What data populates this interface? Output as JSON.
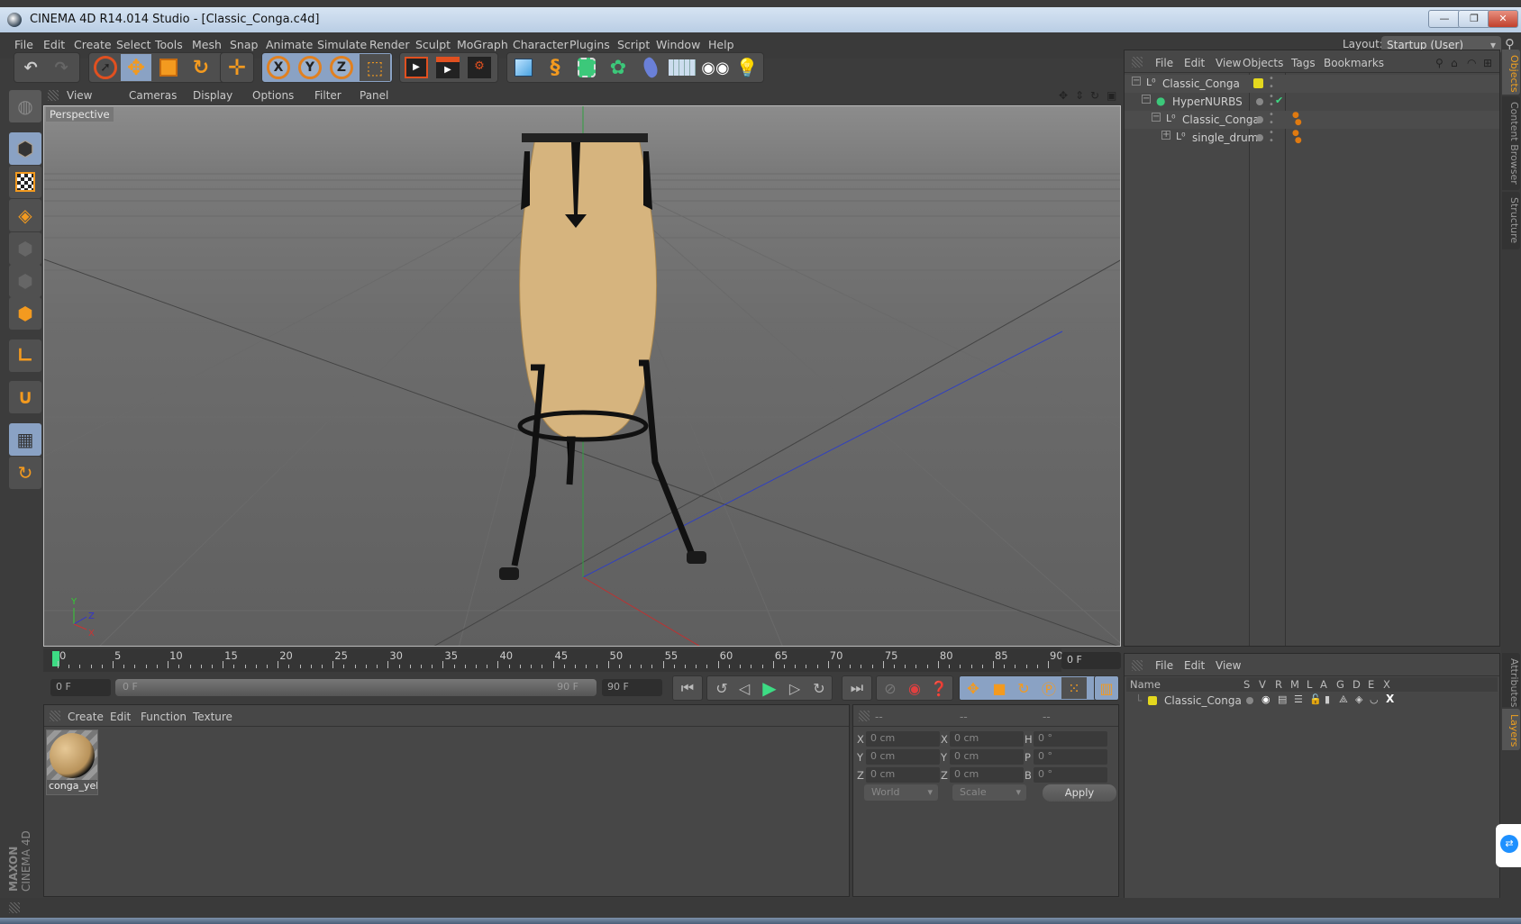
{
  "window": {
    "title": "CINEMA 4D R14.014 Studio - [Classic_Conga.c4d]",
    "controls": {
      "minimize": "—",
      "restore": "❐",
      "close": "✕"
    }
  },
  "menubar": {
    "items": [
      "File",
      "Edit",
      "Create",
      "Select",
      "Tools",
      "Mesh",
      "Snap",
      "Animate",
      "Simulate",
      "Render",
      "Sculpt",
      "MoGraph",
      "Character",
      "Plugins",
      "Script",
      "Window",
      "Help"
    ],
    "layout_label": "Layout:",
    "layout_value": "Startup (User)"
  },
  "toolbar": {
    "groups": [
      {
        "name": "history",
        "tools": [
          "undo-icon",
          "redo-icon"
        ]
      },
      {
        "name": "transform",
        "tools": [
          "live-selection-icon",
          "move-icon",
          "scale-icon",
          "rotate-icon"
        ]
      },
      {
        "name": "last-tool",
        "tools": [
          "create-tool-icon"
        ]
      },
      {
        "name": "axis-lock",
        "tools": [
          "x-axis-icon",
          "y-axis-icon",
          "z-axis-icon",
          "coordinate-system-icon"
        ]
      },
      {
        "name": "render",
        "tools": [
          "render-view-icon",
          "render-picture-viewer-icon",
          "render-settings-icon"
        ]
      },
      {
        "name": "create",
        "tools": [
          "cube-icon",
          "spline-icon",
          "nurbs-icon",
          "array-icon",
          "deformer-icon",
          "floor-icon",
          "camera-icon",
          "light-icon"
        ]
      }
    ],
    "axis_labels": [
      "X",
      "Y",
      "Z"
    ]
  },
  "left_tools": [
    "workplane-icon",
    "model-mode-icon",
    "texture-mode-icon",
    "workplane-grid-icon",
    "points-mode-icon",
    "edges-mode-icon",
    "polygons-mode-icon",
    "axis-mode-icon",
    "snap-magnet-icon",
    "locked-workplane-icon",
    "planar-workplane-icon"
  ],
  "brand": {
    "line1": "MAXON",
    "line2": "CINEMA 4D"
  },
  "viewport": {
    "menu": [
      "View",
      "Cameras",
      "Display",
      "Options",
      "Filter",
      "Panel"
    ],
    "camera_label": "Perspective",
    "nav_icons": [
      "pan-icon",
      "dolly-icon",
      "orbit-icon",
      "maximize-icon"
    ],
    "axis_gizmo": {
      "x": "X",
      "y": "Y",
      "z": "Z"
    }
  },
  "timeline": {
    "ticks": [
      0,
      5,
      10,
      15,
      20,
      25,
      30,
      35,
      40,
      45,
      50,
      55,
      60,
      65,
      70,
      75,
      80,
      85,
      90
    ],
    "current_frame": 0,
    "current_frame_field": "0 F",
    "start_field": "0 F",
    "range_start": "0 F",
    "range_end": "90 F",
    "end_field": "90 F"
  },
  "playback": {
    "buttons": [
      "go-to-start",
      "prev-key",
      "prev-frame",
      "play",
      "next-frame",
      "next-key",
      "go-to-end",
      "record-auto-key",
      "record-key",
      "keyframe-selection",
      "move-key",
      "scale-key",
      "rotate-key",
      "param-key",
      "point-level-key",
      "timeline-window"
    ]
  },
  "materials": {
    "menu": [
      "Create",
      "Edit",
      "Function",
      "Texture"
    ],
    "items": [
      {
        "name": "conga_yell"
      }
    ]
  },
  "coordinates": {
    "headers": [
      "--",
      "--",
      "--"
    ],
    "rows": [
      {
        "l1": "X",
        "v1": "0 cm",
        "l2": "X",
        "v2": "0 cm",
        "l3": "H",
        "v3": "0 °"
      },
      {
        "l1": "Y",
        "v1": "0 cm",
        "l2": "Y",
        "v2": "0 cm",
        "l3": "P",
        "v3": "0 °"
      },
      {
        "l1": "Z",
        "v1": "0 cm",
        "l2": "Z",
        "v2": "0 cm",
        "l3": "B",
        "v3": "0 °"
      }
    ],
    "space": "World",
    "mode": "Scale",
    "apply": "Apply"
  },
  "objects": {
    "menu": [
      "File",
      "Edit",
      "View",
      "Objects",
      "Tags",
      "Bookmarks"
    ],
    "tree": [
      {
        "name": "Classic_Conga",
        "depth": 0,
        "expand": "−",
        "type": "null",
        "layer_color": "#e4d81e",
        "tags": []
      },
      {
        "name": "HyperNURBS",
        "depth": 1,
        "expand": "−",
        "type": "hypernurbs",
        "checked": "✔",
        "tags": []
      },
      {
        "name": "Classic_Conga",
        "depth": 2,
        "expand": "−",
        "type": "null",
        "tags": [
          "phong"
        ]
      },
      {
        "name": "single_drum",
        "depth": 3,
        "expand": "+",
        "type": "null",
        "tags": [
          "phong"
        ]
      }
    ]
  },
  "layers": {
    "menu": [
      "File",
      "Edit",
      "View"
    ],
    "columns": [
      "Name",
      "S",
      "V",
      "R",
      "M",
      "L",
      "A",
      "G",
      "D",
      "E",
      "X"
    ],
    "rows": [
      {
        "name": "Classic_Conga",
        "color": "#e4d81e"
      }
    ]
  },
  "side_tabs": {
    "top": [
      {
        "label": "Objects",
        "active": true
      },
      {
        "label": "Content Browser",
        "active": false
      },
      {
        "label": "Structure",
        "active": false
      }
    ],
    "bottom": [
      {
        "label": "Attributes",
        "active": false
      },
      {
        "label": "Layers",
        "active": true
      }
    ]
  },
  "colors": {
    "accent": "#f39a1f",
    "selected": "#8aa2c4",
    "playhead": "#3ddc84"
  }
}
